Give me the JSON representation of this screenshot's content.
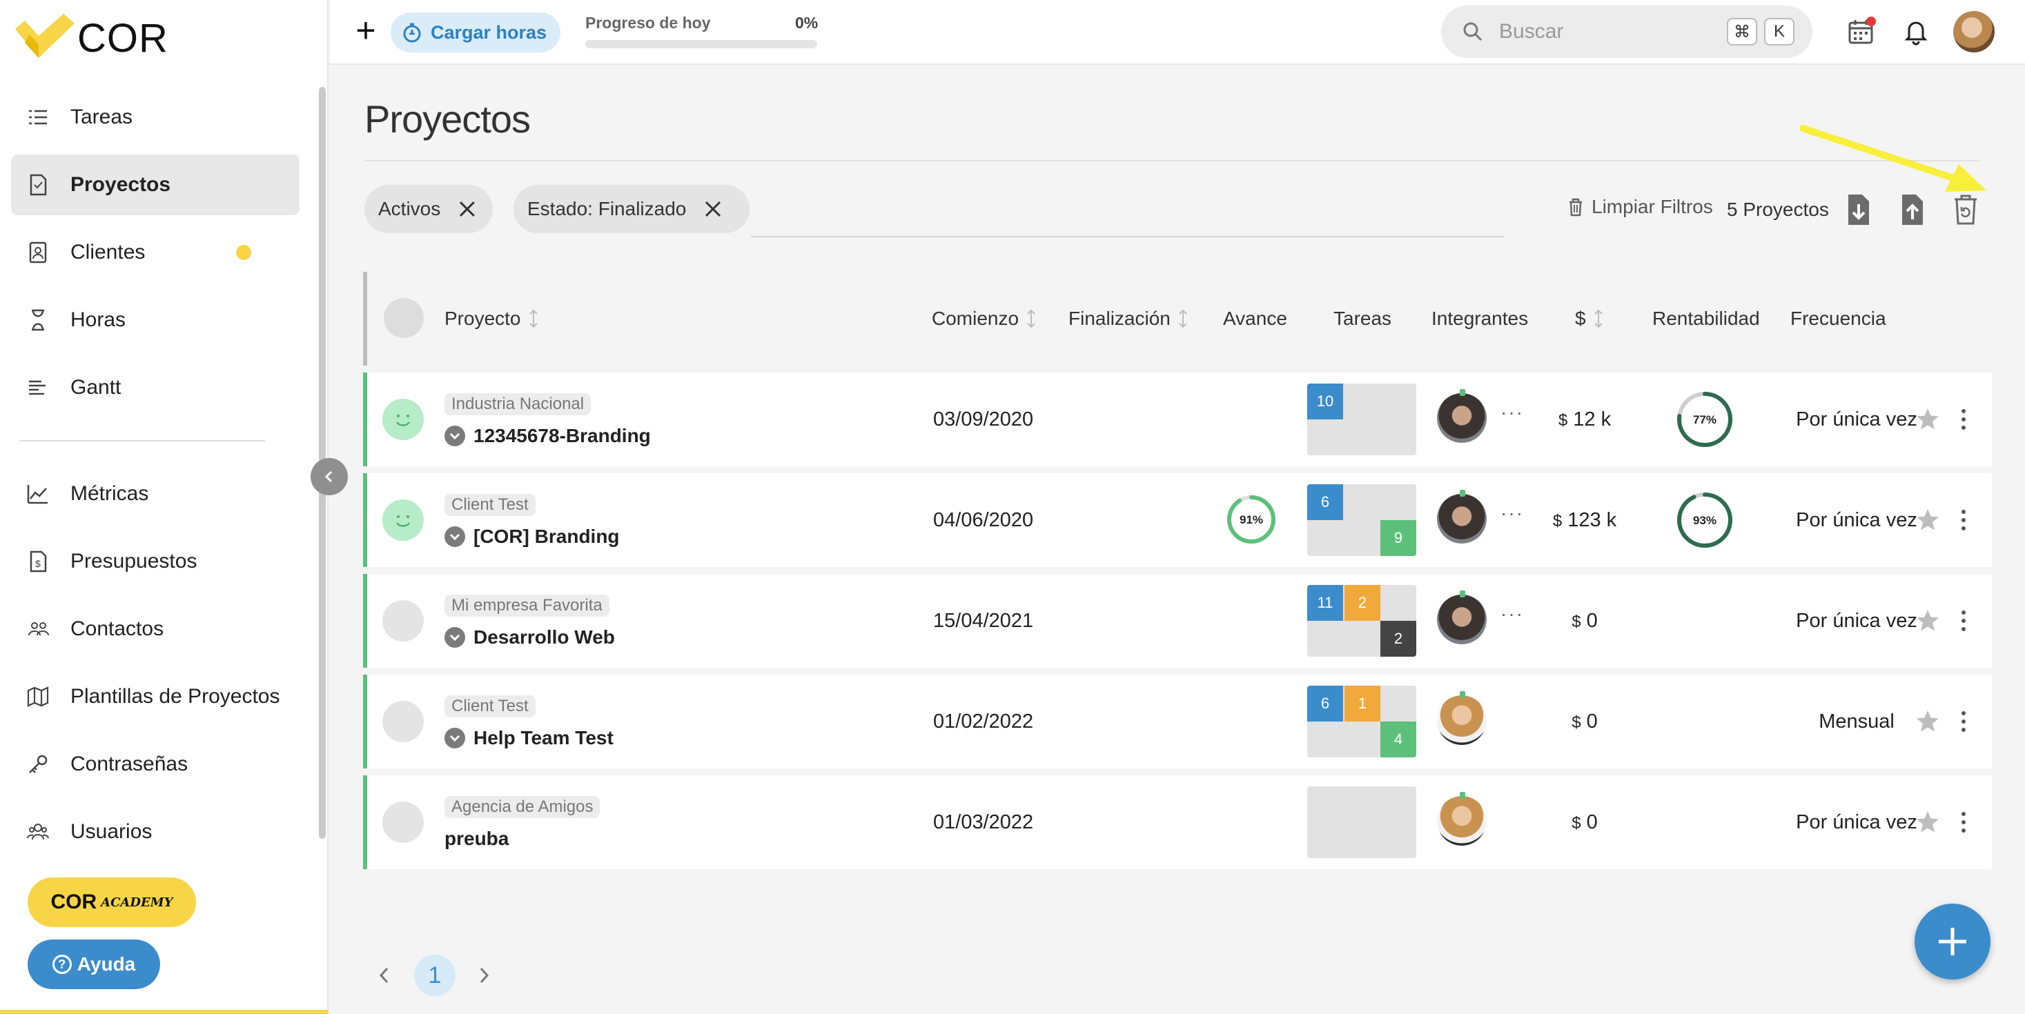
{
  "app": {
    "name": "COR"
  },
  "colors": {
    "brand_yellow": "#f7d547",
    "accent_blue": "#3b8ccb",
    "success_green": "#5cc07a",
    "arrow_yellow": "#f7ef3a"
  },
  "sidebar": {
    "items": [
      {
        "label": "Tareas",
        "icon": "list-icon"
      },
      {
        "label": "Proyectos",
        "icon": "document-icon",
        "active": true
      },
      {
        "label": "Clientes",
        "icon": "client-card-icon",
        "notification": true
      },
      {
        "label": "Horas",
        "icon": "hourglass-icon"
      },
      {
        "label": "Gantt",
        "icon": "gantt-icon"
      },
      {
        "label": "Métricas",
        "icon": "chart-icon"
      },
      {
        "label": "Presupuestos",
        "icon": "budget-icon"
      },
      {
        "label": "Contactos",
        "icon": "contacts-icon"
      },
      {
        "label": "Plantillas de Proyectos",
        "icon": "map-icon"
      },
      {
        "label": "Contraseñas",
        "icon": "key-icon"
      },
      {
        "label": "Usuarios",
        "icon": "users-icon"
      }
    ],
    "academy": {
      "label_main": "COR",
      "label_sub": "ACADEMY"
    },
    "help_label": "Ayuda"
  },
  "topbar": {
    "load_hours_label": "Cargar horas",
    "progress_label": "Progreso de hoy",
    "progress_value": "0%",
    "progress_fraction": 0,
    "search_placeholder": "Buscar",
    "shortcut_keys": [
      "⌘",
      "K"
    ]
  },
  "page": {
    "title": "Proyectos",
    "filters": [
      "Activos",
      "Estado: Finalizado"
    ],
    "clear_filters_label": "Limpiar Filtros",
    "projects_count": "5 Proyectos"
  },
  "table": {
    "headers": {
      "project": "Proyecto",
      "start": "Comienzo",
      "end": "Finalización",
      "progress": "Avance",
      "tasks": "Tareas",
      "members": "Integrantes",
      "money": "$",
      "profitability": "Rentabilidad",
      "frequency": "Frecuencia"
    },
    "rows": [
      {
        "client": "Industria Nacional",
        "name": "12345678-Branding",
        "start": "03/09/2020",
        "progress": null,
        "tasks": [
          {
            "pos": "tl",
            "value": "10",
            "color": "blue"
          }
        ],
        "member": "m1",
        "more": true,
        "currency": "$",
        "amount": "12 k",
        "profitability": "77%",
        "profitability_value": 77,
        "frequency": "Por única vez",
        "happy": true,
        "chevron": true
      },
      {
        "client": "Client Test",
        "name": "[COR] Branding",
        "start": "04/06/2020",
        "progress": "91%",
        "progress_value": 91,
        "tasks": [
          {
            "pos": "tl",
            "value": "6",
            "color": "blue"
          },
          {
            "pos": "br",
            "value": "9",
            "color": "green"
          }
        ],
        "member": "m1",
        "more": true,
        "currency": "$",
        "amount": "123 k",
        "profitability": "93%",
        "profitability_value": 93,
        "frequency": "Por única vez",
        "happy": true,
        "chevron": true
      },
      {
        "client": "Mi empresa Favorita",
        "name": "Desarrollo Web",
        "start": "15/04/2021",
        "progress": null,
        "tasks": [
          {
            "pos": "tl",
            "value": "11",
            "color": "blue"
          },
          {
            "pos": "tr",
            "value": "2",
            "color": "orange"
          },
          {
            "pos": "br",
            "value": "2",
            "color": "dark"
          }
        ],
        "member": "m1",
        "more": true,
        "currency": "$",
        "amount": "0",
        "profitability": null,
        "frequency": "Por única vez",
        "happy": false,
        "chevron": true
      },
      {
        "client": "Client Test",
        "name": "Help Team Test",
        "start": "01/02/2022",
        "progress": null,
        "tasks": [
          {
            "pos": "tl",
            "value": "6",
            "color": "blue"
          },
          {
            "pos": "tr",
            "value": "1",
            "color": "orange"
          },
          {
            "pos": "br",
            "value": "4",
            "color": "green"
          }
        ],
        "member": "m2",
        "more": false,
        "currency": "$",
        "amount": "0",
        "profitability": null,
        "frequency": "Mensual",
        "happy": false,
        "chevron": true
      },
      {
        "client": "Agencia de Amigos",
        "name": "preuba",
        "start": "01/03/2022",
        "progress": null,
        "tasks": [],
        "member": "m2",
        "more": false,
        "currency": "$",
        "amount": "0",
        "profitability": null,
        "frequency": "Por única vez",
        "happy": false,
        "chevron": false
      }
    ]
  },
  "pagination": {
    "current": "1"
  }
}
